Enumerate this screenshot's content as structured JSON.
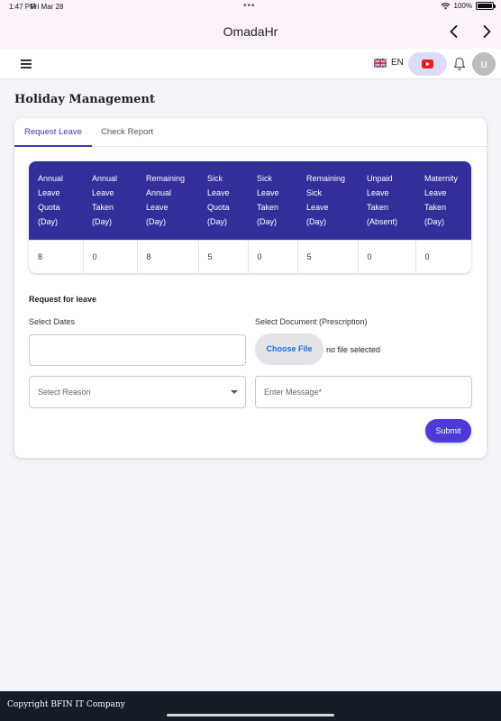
{
  "status_bar": {
    "time": "1:47 PM",
    "date": "Fri Mar 28",
    "battery": "100%"
  },
  "title_bar": {
    "title": "OmadaHr",
    "back_icon": "chevron-left-icon",
    "forward_icon": "chevron-right-icon"
  },
  "header": {
    "menu_icon": "hamburger-menu-icon",
    "language": "EN",
    "flag_icon": "uk-flag-icon",
    "video_icon": "youtube-icon",
    "notification_icon": "bell-icon",
    "avatar_initial": "u"
  },
  "page": {
    "title": "Holiday Management"
  },
  "tabs": [
    {
      "label": "Request Leave",
      "active": true
    },
    {
      "label": "Check Report",
      "active": false
    }
  ],
  "leave_table": {
    "headers": [
      [
        "Annual",
        "Leave",
        "Quota",
        "(Day)"
      ],
      [
        "Annual",
        "Leave",
        "Taken",
        "(Day)"
      ],
      [
        "Remaining",
        "Annual",
        "Leave",
        "(Day)"
      ],
      [
        "Sick",
        "Leave",
        "Quota",
        "(Day)"
      ],
      [
        "Sick",
        "Leave",
        "Taken",
        "(Day)"
      ],
      [
        "Remaining",
        "Sick",
        "Leave",
        "(Day)"
      ],
      [
        "Unpaid",
        "Leave",
        "Taken",
        "(Absent)"
      ],
      [
        "Maternity",
        "Leave",
        "Taken",
        "(Day)"
      ]
    ],
    "values": [
      "8",
      "0",
      "8",
      "5",
      "0",
      "5",
      "0",
      "0"
    ]
  },
  "form": {
    "section_title": "Request for leave",
    "dates_label": "Select Dates",
    "dates_value": "",
    "document_label": "Select Document (Prescription)",
    "choose_file_label": "Choose File",
    "no_file_text": "no file selected",
    "reason_placeholder": "Select Reason",
    "message_placeholder": "Enter Message*",
    "submit_label": "Submit"
  },
  "footer": {
    "copyright": "Copyright BFIN IT Company"
  },
  "colors": {
    "table_header": "#322e9a",
    "accent": "#3a3aa8",
    "submit": "#4b3ad8",
    "footer": "#141c28"
  }
}
